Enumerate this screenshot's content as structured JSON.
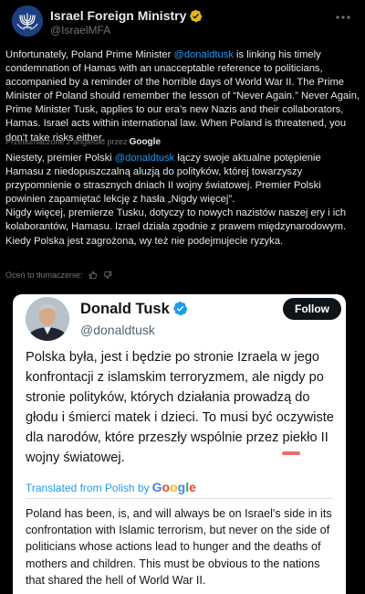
{
  "tweet": {
    "author_name": "Israel Foreign Ministry",
    "author_handle": "@IsraelMFA",
    "text_en_pre": "Unfortunately, Poland Prime Minister ",
    "mention": "@donaldtusk",
    "text_en_post": "  is linking his timely condemnation of Hamas with an unacceptable reference to politicians, accompanied by a reminder of the horrible days of World War II. The Prime Minister of Poland should remember the lesson of “Never Again.” Never Again, Prime Minister Tusk, applies to our era’s new Nazis and their collaborators, Hamas. Israel acts within international law. When Poland is threatened, you don’t take risks either.",
    "translated_by": "Przetłumaczone z angielski przez",
    "translated_by_logo": "Google",
    "text_pl_pre": "Niestety, premier Polski ",
    "text_pl_post": " łączy swoje aktualne potępienie Hamasu z niedopuszczalną aluzją do polityków, której towarzyszy przypomnienie o strasznych dniach II wojny światowej. Premier Polski powinien zapamiętać lekcję z hasła „Nigdy więcej”.",
    "text_pl_2": "Nigdy więcej, premierze Tusku, dotyczy to nowych nazistów naszej ery i ich kolaborantów, Hamasu. Izrael działa zgodnie z prawem międzynarodowym. Kiedy Polska jest zagrożona, wy też nie podejmujecie ryzyka.",
    "rate_translation": "Oceń to tłumaczenie:"
  },
  "quote": {
    "author_name": "Donald Tusk",
    "author_handle": "@donaldtusk",
    "follow_label": "Follow",
    "text_pl": "Polska była, jest i będzie po stronie Izraela w jego konfrontacji z islamskim terroryzmem, ale nigdy po stronie polityków, których działania prowadzą do głodu i śmierci matek i dzieci. To musi być oczywiste dla narodów, które przeszły wspólnie przez piekło II wojny światowej.",
    "translated_from": "Translated from Polish by",
    "google": [
      "G",
      "o",
      "o",
      "g",
      "l",
      "e"
    ],
    "text_en": "Poland has been, is, and will always be on Israel's side in its confrontation with Islamic terrorism, but never on the side of politicians whose actions lead to hunger and the deaths of mothers and children. This must be obvious to the nations that shared the hell of World War II."
  },
  "icons": {
    "verified": "verified-badge-icon",
    "more": "more-options-icon",
    "thumbs_up": "thumbs-up-icon",
    "thumbs_down": "thumbs-down-icon"
  },
  "colors": {
    "background": "#000000",
    "text": "#e7e9ea",
    "muted": "#71767b",
    "link": "#1d9bf0",
    "verified_gold": "#e2b719",
    "verified_blue": "#1d9bf0",
    "quote_bg": "#ffffff"
  }
}
